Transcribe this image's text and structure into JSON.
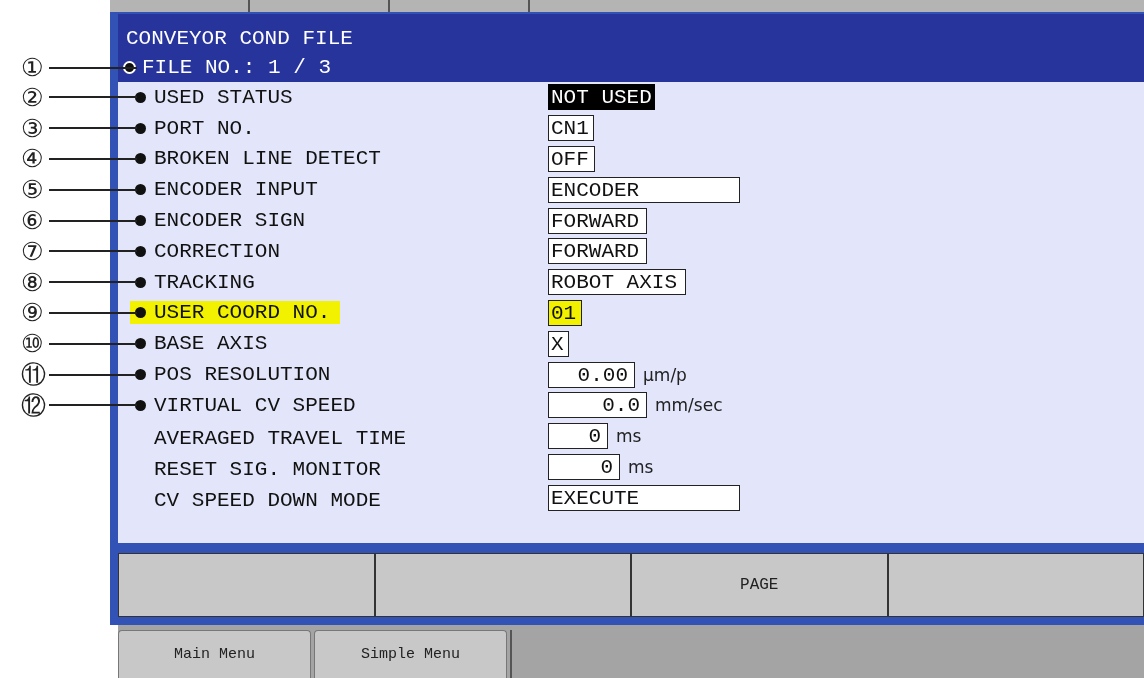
{
  "header": {
    "title": "CONVEYOR COND FILE",
    "file_no": "FILE NO.: 1 / 3",
    "callout": "①"
  },
  "rows": [
    {
      "label": "USED STATUS",
      "value": "NOT USED",
      "kind": "option",
      "callout": "②",
      "selected": true,
      "highlighted": false
    },
    {
      "label": "PORT NO.",
      "value": "CN1",
      "kind": "option",
      "callout": "③",
      "selected": false,
      "highlighted": false
    },
    {
      "label": "BROKEN LINE DETECT",
      "value": "OFF",
      "kind": "option",
      "callout": "④",
      "selected": false,
      "highlighted": false
    },
    {
      "label": "ENCODER INPUT",
      "value": "ENCODER",
      "kind": "option",
      "callout": "⑤",
      "selected": false,
      "highlighted": false
    },
    {
      "label": "ENCODER SIGN",
      "value": "FORWARD",
      "kind": "option",
      "callout": "⑥",
      "selected": false,
      "highlighted": false
    },
    {
      "label": "CORRECTION",
      "value": "FORWARD",
      "kind": "option",
      "callout": "⑦",
      "selected": false,
      "highlighted": false
    },
    {
      "label": "TRACKING",
      "value": "ROBOT AXIS",
      "kind": "option",
      "callout": "⑧",
      "selected": false,
      "highlighted": false
    },
    {
      "label": "USER COORD NO.",
      "value": "01",
      "kind": "option",
      "callout": "⑨",
      "selected": false,
      "highlighted": true
    },
    {
      "label": "BASE AXIS",
      "value": "X",
      "kind": "option",
      "callout": "⑩",
      "selected": false,
      "highlighted": false
    },
    {
      "label": "POS RESOLUTION",
      "value": "0.00",
      "kind": "number",
      "unit": "µm/p",
      "callout": "⑪",
      "selected": false,
      "highlighted": false
    },
    {
      "label": "VIRTUAL CV SPEED",
      "value": "0.0",
      "kind": "number",
      "unit": "mm/sec",
      "callout": "⑫",
      "selected": false,
      "highlighted": false
    },
    {
      "label": "AVERAGED TRAVEL TIME",
      "value": "0",
      "kind": "number",
      "unit": "ms",
      "selected": false,
      "highlighted": false
    },
    {
      "label": "RESET SIG. MONITOR",
      "value": "0",
      "kind": "number",
      "unit": "ms",
      "selected": false,
      "highlighted": false
    },
    {
      "label": "CV SPEED DOWN MODE",
      "value": "EXECUTE",
      "kind": "option",
      "selected": false,
      "highlighted": false
    }
  ],
  "function_keys": [
    {
      "kind": "blank"
    },
    {
      "kind": "blank"
    },
    {
      "kind": "labeled",
      "label": "PAGE"
    },
    {
      "kind": "blank"
    }
  ],
  "menu_tabs": [
    "Main Menu",
    "Simple Menu"
  ]
}
